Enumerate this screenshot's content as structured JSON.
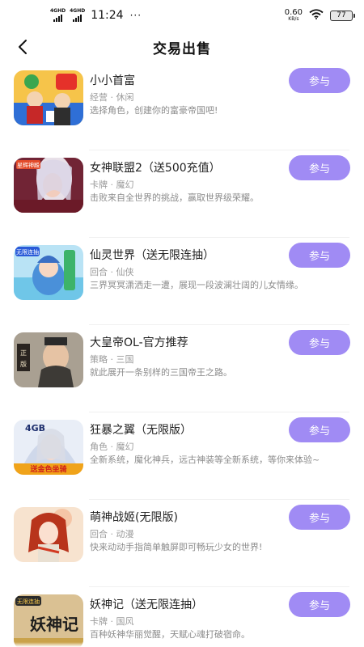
{
  "status_bar": {
    "signal1": "4GHD",
    "signal2": "4GHD",
    "time": "11:24",
    "dots": "···",
    "speed_value": "0.60",
    "speed_unit": "KB/s",
    "battery": "77"
  },
  "header": {
    "title": "交易出售",
    "back_icon": "chevron-left-icon"
  },
  "accent_color": "#a08bf4",
  "games": [
    {
      "name": "小小首富",
      "tags": "经营 · 休闲",
      "desc": "选择角色，创建你的富豪帝国吧!",
      "button": "参与"
    },
    {
      "name": "女神联盟2（送500充值）",
      "tags": "卡牌 · 魔幻",
      "desc": "击败来自全世界的挑战，赢取世界级荣耀。",
      "button": "参与"
    },
    {
      "name": "仙灵世界（送无限连抽）",
      "tags": "回合 · 仙侠",
      "desc": "三界冥冥潇洒走一遭，展现一段波澜壮阔的儿女情缘。",
      "button": "参与"
    },
    {
      "name": "大皇帝OL-官方推荐",
      "tags": "策略 · 三国",
      "desc": "就此展开一条别样的三国帝王之路。",
      "button": "参与"
    },
    {
      "name": "狂暴之翼（无限版）",
      "tags": "角色 · 魔幻",
      "desc": "全新系统，魔化神兵，远古神装等全新系统，等你来体验~",
      "button": "参与"
    },
    {
      "name": "萌神战姬(无限版)",
      "tags": "回合 · 动漫",
      "desc": "快来动动手指简单触屏即可畅玩少女的世界!",
      "button": "参与"
    },
    {
      "name": "妖神记（送无限连抽）",
      "tags": "卡牌 · 国风",
      "desc": "百种妖神华丽觉醒，天赋心魂打破宿命。",
      "button": "参与"
    }
  ],
  "thumb_badges": {
    "g2": "星辉神殿",
    "g3": "无限连抽",
    "g4": "正版",
    "g5_top": "4GB",
    "g5_bottom": "送金色坐骑",
    "g7_top": "无限连抽",
    "g7_main": "妖神记"
  }
}
